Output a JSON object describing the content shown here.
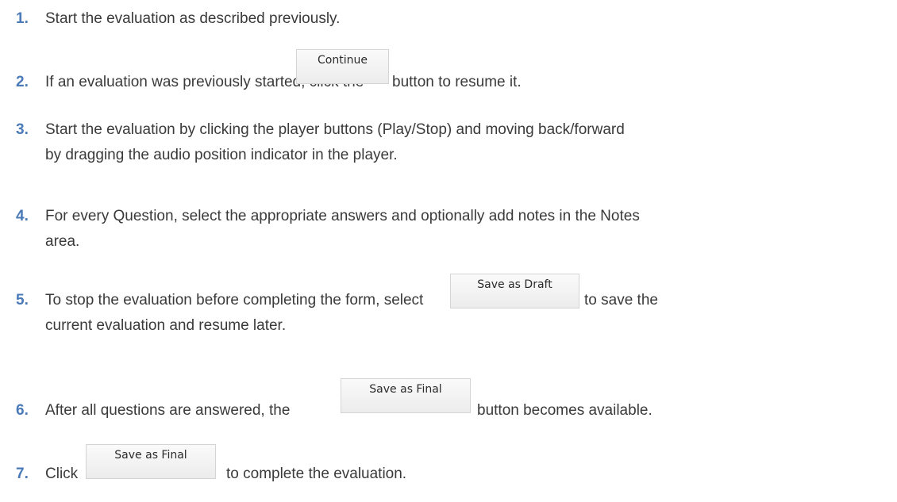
{
  "steps": [
    {
      "number": "1.",
      "text": "Start the evaluation as described previously."
    },
    {
      "number": "2.",
      "before": "If an evaluation was previously started, click the",
      "button": "Continue",
      "after": "button to resume it."
    },
    {
      "number": "3.",
      "line1": "Start the evaluation by clicking the player buttons (Play/Stop) and moving back/forward",
      "line2": "by dragging the audio position indicator in the player."
    },
    {
      "number": "4.",
      "line1": "For every Question, select the appropriate answers and optionally add notes in the Notes",
      "line2": "area."
    },
    {
      "number": "5.",
      "before": "To stop the evaluation before completing the form, select",
      "button": "Save as Draft",
      "after": "to save the",
      "line2": "current evaluation and resume later."
    },
    {
      "number": "6.",
      "before": "After all questions are answered, the",
      "button": "Save as Final",
      "after": "button becomes available."
    },
    {
      "number": "7.",
      "before": "Click",
      "button": "Save as Final",
      "after": "to complete the evaluation."
    }
  ]
}
